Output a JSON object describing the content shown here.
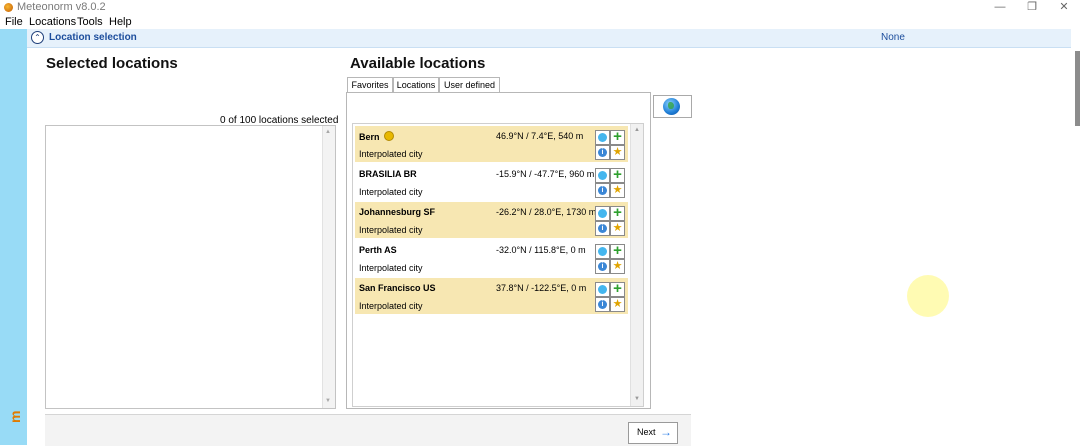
{
  "window": {
    "title": "Meteonorm v8.0.2",
    "controls": {
      "minimize": "—",
      "restore": "❐",
      "close": "✕"
    }
  },
  "menu": [
    "File",
    "Locations",
    "Tools",
    "Help"
  ],
  "side_strip_text": "m",
  "section_header": {
    "title": "Location selection",
    "value": "None"
  },
  "selected": {
    "title": "Selected locations",
    "count_text": "0 of 100 locations selected"
  },
  "available": {
    "title": "Available locations",
    "tabs": [
      "Favorites",
      "Locations",
      "User defined"
    ],
    "active_tab": "Favorites",
    "items": [
      {
        "name": "Bern",
        "coords": "46.9°N / 7.4°E, 540 m",
        "type": "Interpolated city",
        "highlighted": true,
        "sun_icon": true
      },
      {
        "name": "BRASILIA BR",
        "coords": "-15.9°N / -47.7°E, 960 m",
        "type": "Interpolated city",
        "highlighted": false
      },
      {
        "name": "Johannesburg SF",
        "coords": "-26.2°N / 28.0°E, 1730 m",
        "type": "Interpolated city",
        "highlighted": true
      },
      {
        "name": "Perth AS",
        "coords": "-32.0°N / 115.8°E, 0 m",
        "type": "Interpolated city",
        "highlighted": false
      },
      {
        "name": "San Francisco US",
        "coords": "37.8°N / -122.5°E, 0 m",
        "type": "Interpolated city",
        "highlighted": true
      }
    ]
  },
  "buttons": {
    "next": "Next",
    "next_arrow": "→"
  },
  "glyphs": {
    "collapse": "⌃",
    "plus": "+",
    "star": "★",
    "info": "i",
    "scroll_up": "▲",
    "scroll_down": "▼"
  },
  "colors": {
    "side_strip": "#98dbf6",
    "highlight_row": "#f7e7b2",
    "header_text": "#1c4d9c"
  }
}
